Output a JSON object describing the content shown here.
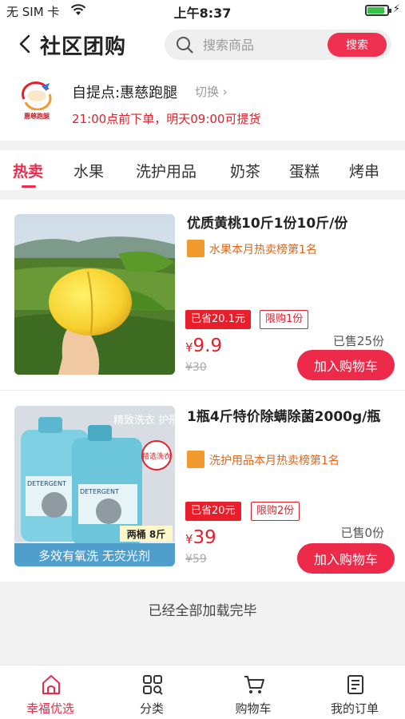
{
  "status_bar": {
    "carrier": "无 SIM 卡",
    "time": "上午8:37",
    "battery_level": 0.8
  },
  "header": {
    "title": "社区团购",
    "search_placeholder": "搜索商品",
    "search_button": "搜索"
  },
  "pickup": {
    "logo_text": "惠慈跑腿",
    "label": "自提点:惠慈跑腿",
    "switch_label": "切换",
    "notice": "21:00点前下单，明天09:00可提货"
  },
  "category_tabs": [
    "热卖",
    "水果",
    "洗护用品",
    "奶茶",
    "蛋糕",
    "烤串"
  ],
  "active_tab": "热卖",
  "products": [
    {
      "title": "优质黄桃10斤1份10斤/份",
      "rank_text": "水果本月热卖榜第1名",
      "save_text": "已省20.1元",
      "limit_text": "限购1份",
      "currency": "¥",
      "price": "9.9",
      "original_price": "¥30",
      "sold_text": "已售25份",
      "cart_button": "加入购物车"
    },
    {
      "title": "1瓶4斤特价除螨除菌2000g/瓶",
      "rank_text": "洗护用品本月热卖榜第1名",
      "save_text": "已省20元",
      "limit_text": "限购2份",
      "currency": "¥",
      "price": "39",
      "original_price": "¥59",
      "sold_text": "已售0份",
      "cart_button": "加入购物车",
      "image_text": {
        "brand_line": "精致洗衣 护形护色",
        "seal": "精选洗衣",
        "label": "DETERGENT",
        "twin_badge": "两桶 8斤",
        "banner": "多效有氧洗 无荧光剂"
      }
    }
  ],
  "end_of_list": "已经全部加载完毕",
  "bottom_tabs": [
    {
      "label": "幸福优选",
      "icon": "home-icon"
    },
    {
      "label": "分类",
      "icon": "category-grid-icon"
    },
    {
      "label": "购物车",
      "icon": "cart-icon"
    },
    {
      "label": "我的订单",
      "icon": "order-list-icon"
    }
  ],
  "colors": {
    "accent": "#ee2a4a",
    "price_red": "#e81f2a",
    "rank_orange": "#e06516"
  }
}
